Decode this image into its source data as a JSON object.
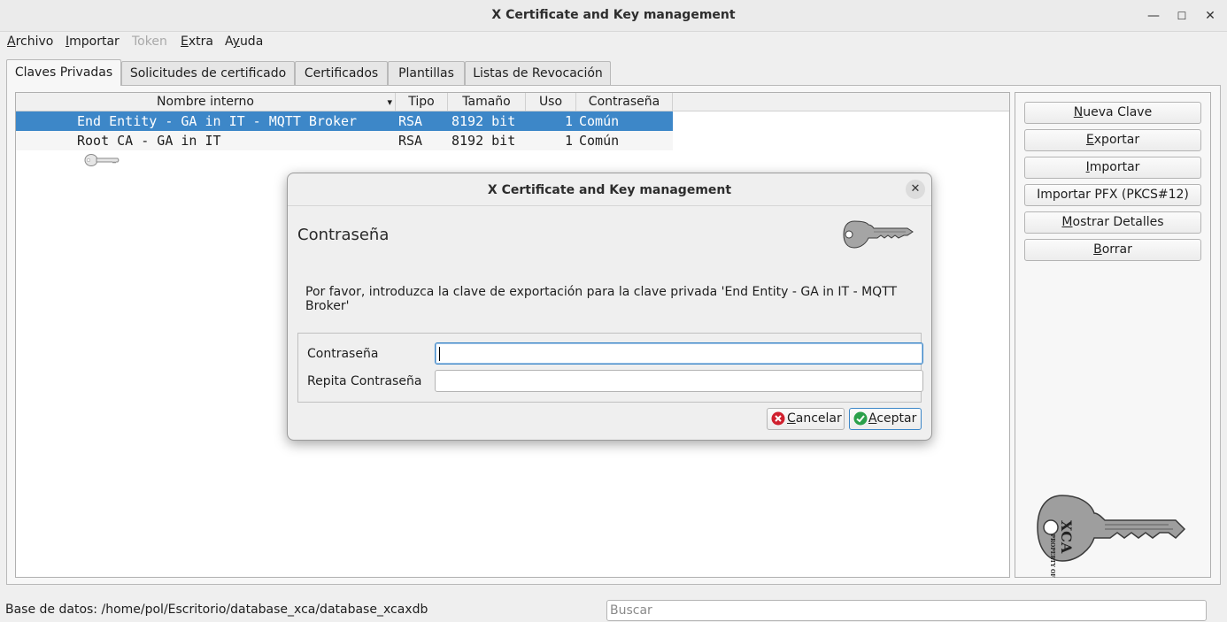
{
  "window": {
    "title": "X Certificate and Key management",
    "controls": [
      "—",
      "☐",
      "✕"
    ]
  },
  "menu": {
    "items": [
      {
        "label": "Archivo",
        "underline_index": 0,
        "enabled": true
      },
      {
        "label": "Importar",
        "underline_index": 0,
        "enabled": true
      },
      {
        "label": "Token",
        "underline_index": -1,
        "enabled": false
      },
      {
        "label": "Extra",
        "underline_index": 0,
        "enabled": true
      },
      {
        "label": "Ayuda",
        "underline_index": 1,
        "enabled": true
      }
    ]
  },
  "tabs": [
    {
      "label": "Claves Privadas",
      "active": true
    },
    {
      "label": "Solicitudes de certificado",
      "active": false
    },
    {
      "label": "Certificados",
      "active": false
    },
    {
      "label": "Plantillas",
      "active": false
    },
    {
      "label": "Listas de Revocación",
      "active": false
    }
  ],
  "keys_table": {
    "columns": [
      "Nombre interno",
      "Tipo",
      "Tamaño",
      "Uso",
      "Contraseña"
    ],
    "sort_indicator": "▾",
    "rows": [
      {
        "name": "End Entity - GA in IT - MQTT Broker",
        "type": "RSA",
        "size": "8192 bit",
        "use": "1",
        "password": "Común",
        "selected": true
      },
      {
        "name": "Root CA - GA in IT",
        "type": "RSA",
        "size": "8192 bit",
        "use": "1",
        "password": "Común",
        "selected": false
      }
    ]
  },
  "side_buttons": [
    {
      "label": "Nueva Clave",
      "underline_index": 0
    },
    {
      "label": "Exportar",
      "underline_index": 0
    },
    {
      "label": "Importar",
      "underline_index": 0
    },
    {
      "label": "Importar PFX (PKCS#12)",
      "underline_index": -1
    },
    {
      "label": "Mostrar Detalles",
      "underline_index": 0
    },
    {
      "label": "Borrar",
      "underline_index": 0
    }
  ],
  "logo_text": {
    "line1": "PROPERTY OF",
    "line2": "XCA"
  },
  "status": {
    "database": "Base de datos: /home/pol/Escritorio/database_xca/database_xcaxdb",
    "search_placeholder": "Buscar"
  },
  "dialog": {
    "title": "X Certificate and Key management",
    "close": "✕",
    "heading": "Contraseña",
    "message": "Por favor, introduzca la clave de exportación para la clave privada 'End Entity - GA in IT - MQTT Broker'",
    "password_label": "Contraseña",
    "password_value": "",
    "repeat_label": "Repita Contraseña",
    "repeat_value": "",
    "cancel_label": "Cancelar",
    "accept_label": "Aceptar",
    "cancel_icon": "cancel-icon",
    "accept_icon": "ok-icon",
    "accent_cancel": "#d0202e",
    "accent_accept": "#2aa04a"
  }
}
